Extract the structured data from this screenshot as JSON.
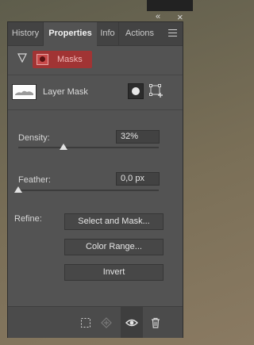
{
  "window": {
    "collapse_icon": "«",
    "close_icon": "×"
  },
  "tabs": [
    {
      "label": "History"
    },
    {
      "label": "Properties"
    },
    {
      "label": "Info"
    },
    {
      "label": "Actions"
    }
  ],
  "section": {
    "label": "Masks"
  },
  "layer": {
    "label": "Layer Mask"
  },
  "density": {
    "label": "Density:",
    "value": "32%",
    "level_percent": 32
  },
  "feather": {
    "label": "Feather:",
    "value": "0,0 px",
    "level_percent": 0
  },
  "refine": {
    "label": "Refine:",
    "buttons": [
      "Select and Mask...",
      "Color Range...",
      "Invert"
    ]
  },
  "colors": {
    "masks_badge": "#a13434",
    "panel": "#535353",
    "tabbar": "#434343"
  },
  "icons": [
    "collapse-icon",
    "close-icon",
    "panel-menu-icon",
    "collapse-triangle-icon",
    "mask-icon",
    "pixel-mask-icon",
    "vector-mask-icon",
    "load-selection-icon",
    "apply-mask-icon",
    "visibility-eye-icon",
    "trash-icon"
  ]
}
